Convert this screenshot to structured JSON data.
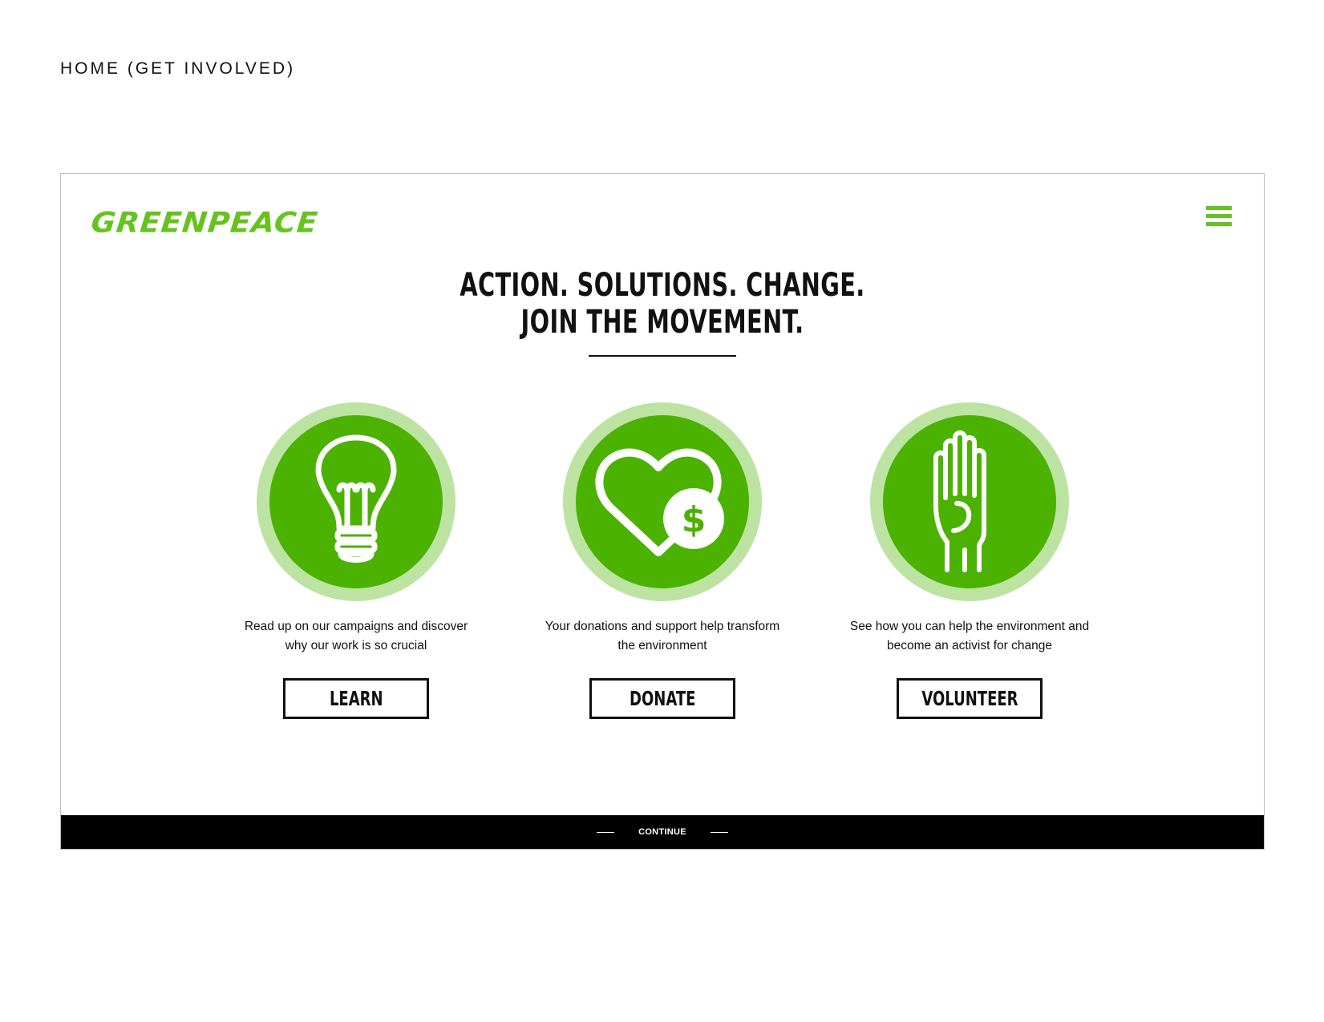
{
  "page_label": "HOME (GET INVOLVED)",
  "header": {
    "logo_text": "GREENPEACE",
    "menu_icon": "hamburger-menu-icon"
  },
  "headline": {
    "line1": "ACTION. SOLUTIONS. CHANGE.",
    "line2": "JOIN THE MOVEMENT."
  },
  "cards": [
    {
      "icon": "lightbulb-icon",
      "description": "Read up on our campaigns and discover why our work is so crucial",
      "button_label": "LEARN"
    },
    {
      "icon": "heart-dollar-icon",
      "description": "Your donations and support help transform the environment",
      "button_label": "DONATE"
    },
    {
      "icon": "raised-hand-icon",
      "description": "See how you can help the environment and become an activist for change",
      "button_label": "VOLUNTEER"
    }
  ],
  "footer": {
    "continue_label": "CONTINUE"
  },
  "colors": {
    "brand_green": "#66c21e",
    "circle_green": "#4cb202",
    "circle_ring": "#bde3a3",
    "footer_bg": "#000000"
  }
}
